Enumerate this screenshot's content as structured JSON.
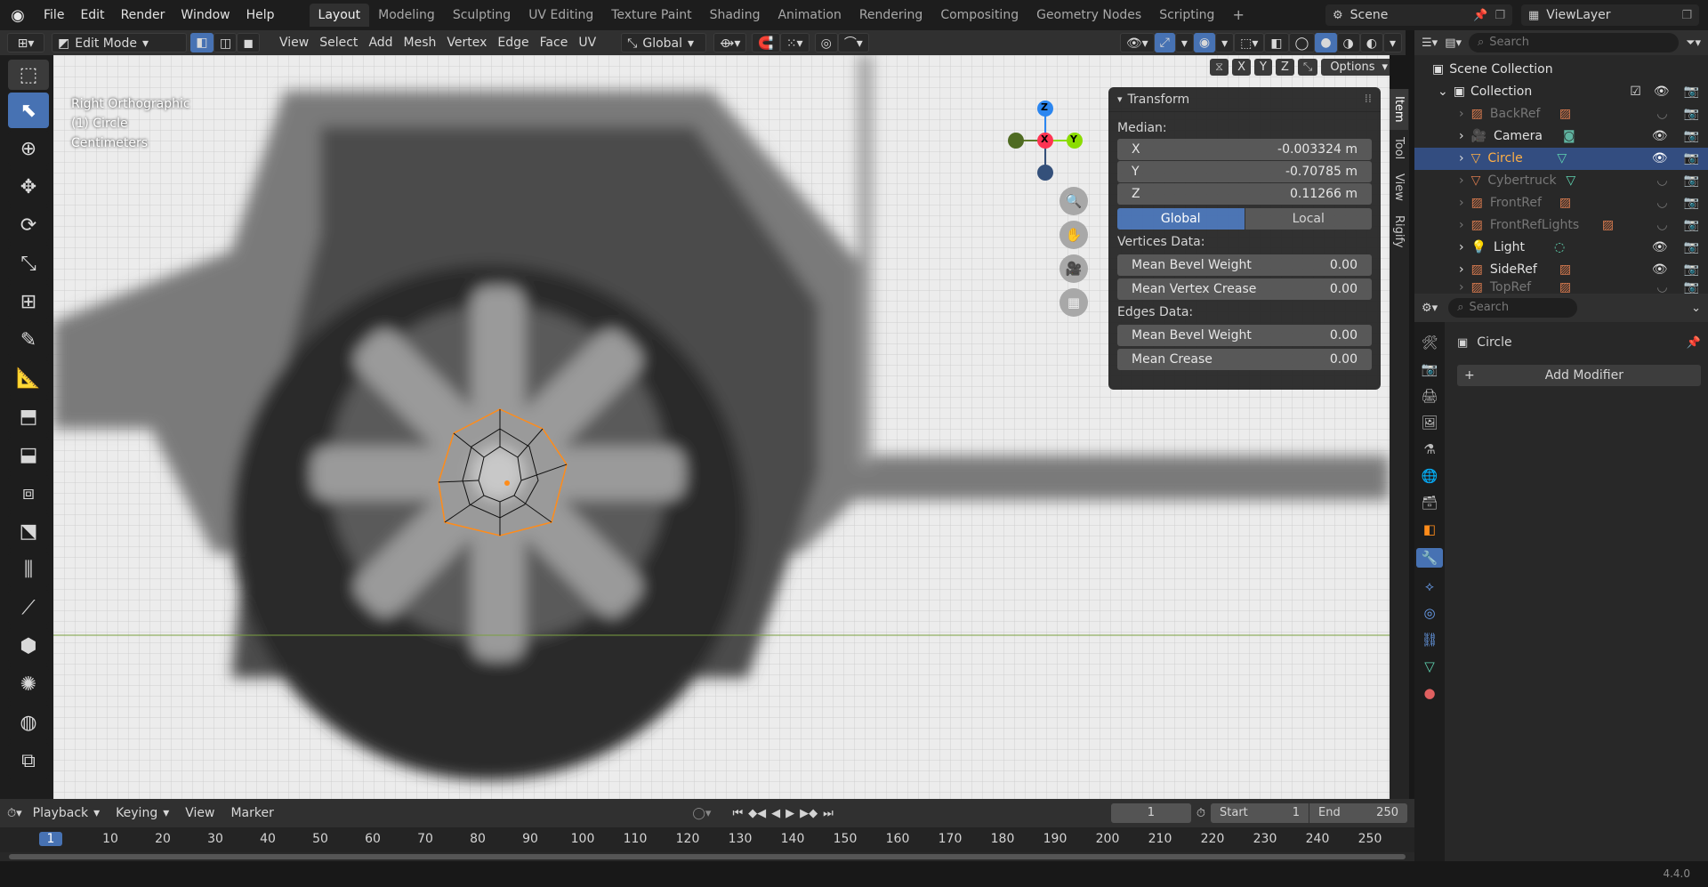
{
  "app": {
    "version": "4.4.0"
  },
  "menu": [
    "File",
    "Edit",
    "Render",
    "Window",
    "Help"
  ],
  "workspaces": [
    "Layout",
    "Modeling",
    "Sculpting",
    "UV Editing",
    "Texture Paint",
    "Shading",
    "Animation",
    "Rendering",
    "Compositing",
    "Geometry Nodes",
    "Scripting"
  ],
  "active_workspace": "Layout",
  "scene_name": "Scene",
  "view_layer": "ViewLayer",
  "header": {
    "mode": "Edit Mode",
    "menus": [
      "View",
      "Select",
      "Add",
      "Mesh",
      "Vertex",
      "Edge",
      "Face",
      "UV"
    ],
    "orientation": "Global",
    "axes": [
      "X",
      "Y",
      "Z"
    ],
    "options_label": "Options"
  },
  "viewport": {
    "view_name": "Right Orthographic",
    "object_name": "(1) Circle",
    "units": "Centimeters",
    "gizmo": {
      "z": "Z",
      "x": "X",
      "y": "Y"
    }
  },
  "sidebar_tabs": [
    "Item",
    "Tool",
    "View",
    "Rigify"
  ],
  "transform": {
    "title": "Transform",
    "median_label": "Median:",
    "x_label": "X",
    "x_value": "-0.003324 m",
    "y_label": "Y",
    "y_value": "-0.70785 m",
    "z_label": "Z",
    "z_value": "0.11266 m",
    "global_label": "Global",
    "local_label": "Local",
    "vertices_label": "Vertices Data:",
    "mean_bevel_weight_label": "Mean Bevel Weight",
    "mean_bevel_weight_value": "0.00",
    "mean_vertex_crease_label": "Mean Vertex Crease",
    "mean_vertex_crease_value": "0.00",
    "edges_label": "Edges Data:",
    "edge_bevel_weight_label": "Mean Bevel Weight",
    "edge_bevel_weight_value": "0.00",
    "mean_crease_label": "Mean Crease",
    "mean_crease_value": "0.00"
  },
  "outliner": {
    "search_placeholder": "Search",
    "scene_collection": "Scene Collection",
    "collection": "Collection",
    "items": [
      "BackRef",
      "Camera",
      "Circle",
      "Cybertruck",
      "FrontRef",
      "FrontRefLights",
      "Light",
      "SideRef",
      "TopRef"
    ]
  },
  "properties": {
    "search_placeholder": "Search",
    "object_name": "Circle",
    "add_modifier_label": "Add Modifier"
  },
  "timeline": {
    "menus": [
      "Playback",
      "Keying",
      "View",
      "Marker"
    ],
    "current_frame": "1",
    "start_label": "Start",
    "start_value": "1",
    "end_label": "End",
    "end_value": "250",
    "ruler": [
      "1",
      "10",
      "20",
      "30",
      "40",
      "50",
      "60",
      "70",
      "80",
      "90",
      "100",
      "110",
      "120",
      "130",
      "140",
      "150",
      "160",
      "170",
      "180",
      "190",
      "200",
      "210",
      "220",
      "230",
      "240",
      "250"
    ]
  },
  "colors": {
    "accent": "#4772b3",
    "selected_orange": "#ff8c1a",
    "axis_x": "#ff3352",
    "axis_y": "#8bdc00",
    "axis_z": "#2b86f0"
  }
}
